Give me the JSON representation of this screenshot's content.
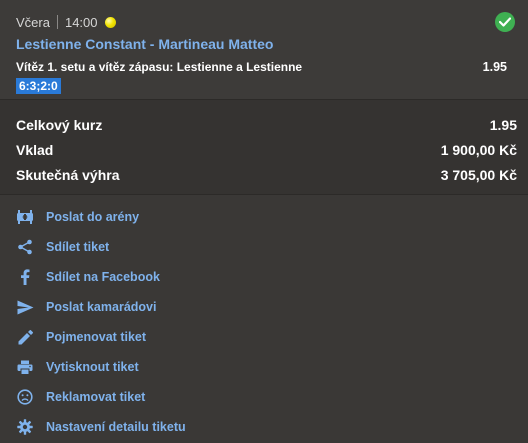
{
  "bet": {
    "day": "Včera",
    "time": "14:00",
    "match": "Lestienne Constant - Martineau Matteo",
    "pick": "Vítěz 1. setu a vítěz zápasu: Lestienne a Lestienne",
    "odd": "1.95",
    "score": "6:3;2:0",
    "status_icon": "check-icon",
    "sport_icon": "tennis-ball-icon"
  },
  "totals": [
    {
      "label": "Celkový kurz",
      "value": "1.95"
    },
    {
      "label": "Vklad",
      "value": "1 900,00 Kč"
    },
    {
      "label": "Skutečná výhra",
      "value": "3 705,00 Kč"
    }
  ],
  "actions": [
    {
      "label": "Poslat do arény",
      "icon": "arena-icon"
    },
    {
      "label": "Sdílet tiket",
      "icon": "share-icon"
    },
    {
      "label": "Sdílet na Facebook",
      "icon": "facebook-icon"
    },
    {
      "label": "Poslat kamarádovi",
      "icon": "send-icon"
    },
    {
      "label": "Pojmenovat tiket",
      "icon": "pencil-icon"
    },
    {
      "label": "Vytisknout tiket",
      "icon": "printer-icon"
    },
    {
      "label": "Reklamovat tiket",
      "icon": "sad-face-icon"
    },
    {
      "label": "Nastavení detailu tiketu",
      "icon": "gear-icon"
    }
  ],
  "colors": {
    "link": "#7fb2ec",
    "success": "#3fb052",
    "score_badge": "#2a7ad8"
  }
}
